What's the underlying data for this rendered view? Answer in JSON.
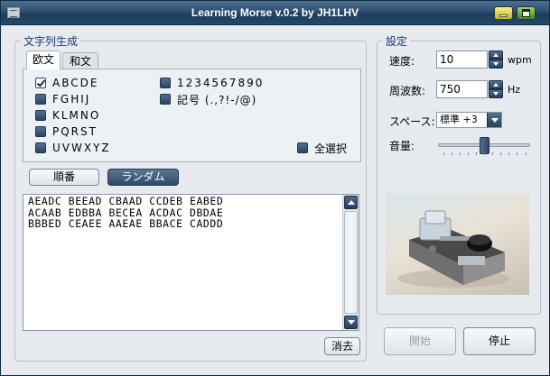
{
  "window": {
    "title": "Learning Morse v.0.2 by JH1LHV"
  },
  "left_group": {
    "legend": "文字列生成",
    "tabs": [
      {
        "label": "欧文"
      },
      {
        "label": "和文"
      }
    ],
    "checkboxes": [
      {
        "label": "ABCDE",
        "checked": true
      },
      {
        "label": "FGHIJ",
        "checked": false
      },
      {
        "label": "KLMNO",
        "checked": false
      },
      {
        "label": "PQRST",
        "checked": false
      },
      {
        "label": "UVWXYZ",
        "checked": false
      },
      {
        "label": "1234567890",
        "checked": false
      },
      {
        "label": "記号 (.,?!-/@)",
        "checked": false
      }
    ],
    "select_all": {
      "label": "全選択",
      "checked": false
    },
    "order_button": "順番",
    "random_button": "ランダム",
    "output_text": "AEADC BEEAD CBAAD CCDEB EABED\nACAAB EDBBA BECEA ACDAC DBDAE\nBBBED CEAEE AAEAE BBACE CADDD",
    "clear_button": "消去"
  },
  "right_group": {
    "legend": "設定",
    "speed": {
      "label": "速度:",
      "value": "10",
      "unit": "wpm"
    },
    "frequency": {
      "label": "周波数:",
      "value": "750",
      "unit": "Hz"
    },
    "space": {
      "label": "スペース:",
      "value": "標準 +3"
    },
    "volume": {
      "label": "音量:",
      "level": 0.5
    },
    "photo_icon": "morse-key-photo"
  },
  "controls": {
    "start_button": "開始",
    "stop_button": "停止"
  }
}
